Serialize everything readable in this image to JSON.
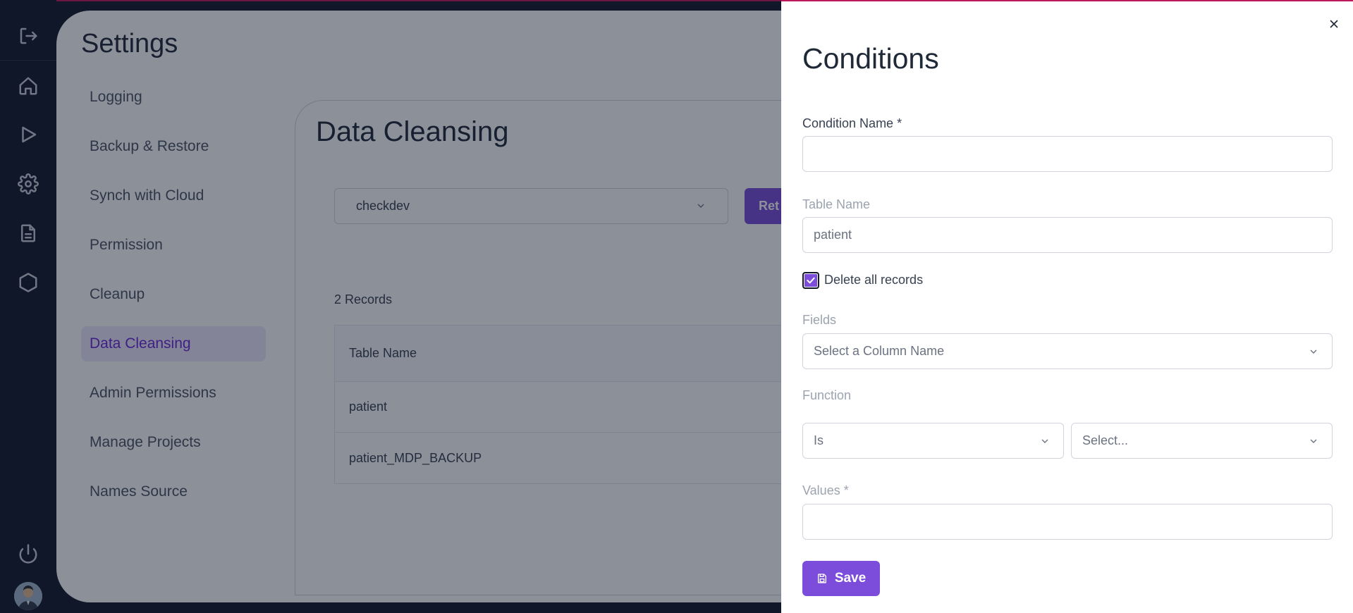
{
  "colors": {
    "accent": "#7c4ddb",
    "top_line": "#be185d",
    "rail_bg": "#111827"
  },
  "rail": {
    "icons": [
      "logout-icon",
      "home-icon",
      "play-icon",
      "gear-icon",
      "document-icon",
      "hexagon-icon",
      "power-icon"
    ]
  },
  "page": {
    "title": "Settings",
    "nav": [
      "Logging",
      "Backup & Restore",
      "Synch with Cloud",
      "Permission",
      "Cleanup",
      "Data Cleansing",
      "Admin Permissions",
      "Manage Projects",
      "Names Source"
    ],
    "active_nav": "Data Cleansing"
  },
  "panel": {
    "title": "Data Cleansing",
    "database_value": "checkdev",
    "button_partial": "Ret",
    "records": "2 Records",
    "table": {
      "header": "Table Name",
      "rows": [
        "patient",
        "patient_MDP_BACKUP"
      ]
    }
  },
  "drawer": {
    "title": "Conditions",
    "condition_name_label": "Condition Name *",
    "condition_name_value": "",
    "table_name_label": "Table Name",
    "table_name_value": "patient",
    "delete_all_label": "Delete all records",
    "delete_all_checked": true,
    "fields_label": "Fields",
    "fields_placeholder": "Select a Column Name",
    "function_label": "Function",
    "function_operator": "Is",
    "function_value_placeholder": "Select...",
    "values_label": "Values *",
    "values_value": "",
    "save_label": "Save"
  }
}
